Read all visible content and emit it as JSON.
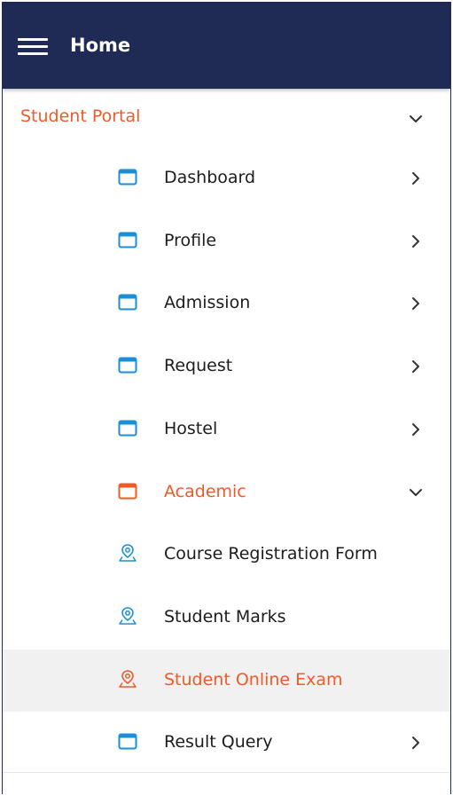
{
  "header": {
    "title": "Home"
  },
  "section": {
    "label": "Student Portal"
  },
  "menu": [
    {
      "label": "Dashboard",
      "icon": "window-icon",
      "chevron": "right",
      "color": "default",
      "active": false
    },
    {
      "label": "Profile",
      "icon": "window-icon",
      "chevron": "right",
      "color": "default",
      "active": false
    },
    {
      "label": "Admission",
      "icon": "window-icon",
      "chevron": "right",
      "color": "default",
      "active": false
    },
    {
      "label": "Request",
      "icon": "window-icon",
      "chevron": "right",
      "color": "default",
      "active": false
    },
    {
      "label": "Hostel",
      "icon": "window-icon",
      "chevron": "right",
      "color": "default",
      "active": false
    },
    {
      "label": "Academic",
      "icon": "window-icon",
      "chevron": "down",
      "color": "orange",
      "active": false
    },
    {
      "label": "Course Registration Form",
      "icon": "location-pin-icon",
      "chevron": "none",
      "color": "default",
      "active": false
    },
    {
      "label": "Student Marks",
      "icon": "location-pin-icon",
      "chevron": "none",
      "color": "default",
      "active": false
    },
    {
      "label": "Student Online Exam",
      "icon": "location-pin-icon",
      "chevron": "none",
      "color": "orange",
      "active": true
    },
    {
      "label": "Result Query",
      "icon": "window-icon",
      "chevron": "right",
      "color": "default",
      "active": false
    }
  ],
  "colors": {
    "header_bg": "#1f2a55",
    "accent": "#f05a28",
    "icon_blue": "#1a8fd6",
    "active_bg": "#f1f1f1"
  }
}
